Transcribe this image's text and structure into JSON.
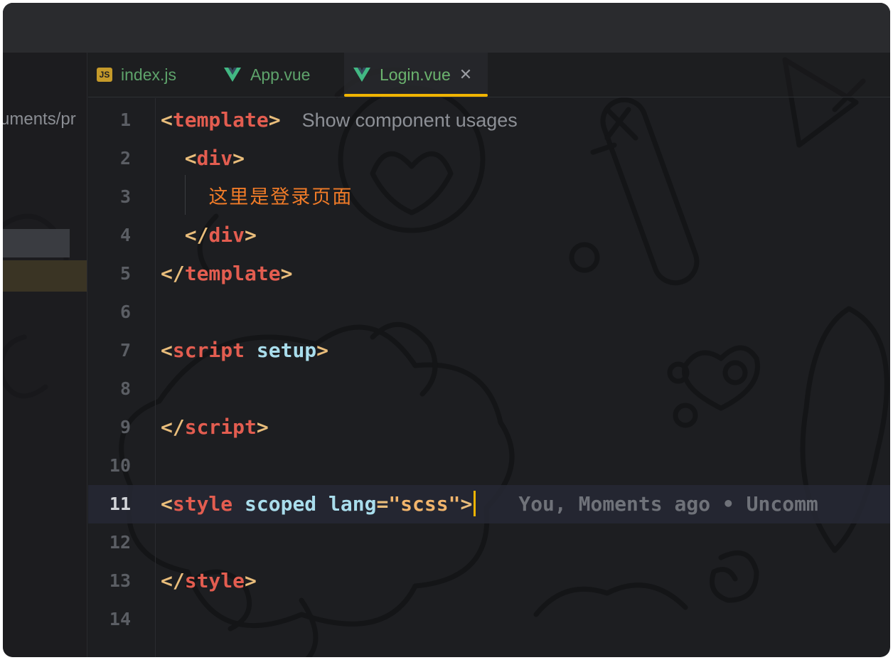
{
  "sidebar": {
    "path_fragment": "uments/pr"
  },
  "tabs": [
    {
      "label": "index.js",
      "icon": "js-file-icon",
      "badge": "JS",
      "active": false
    },
    {
      "label": "App.vue",
      "icon": "vue-file-icon",
      "active": false
    },
    {
      "label": "Login.vue",
      "icon": "vue-file-icon",
      "active": true
    }
  ],
  "colors": {
    "accent": "#f0b400",
    "vue_green": "#42b883",
    "tag": "#e35d50",
    "bracket": "#e9bd7b",
    "attr": "#a9ddec",
    "text_cn": "#f07b28"
  },
  "editor": {
    "line_numbers": [
      "1",
      "2",
      "3",
      "4",
      "5",
      "6",
      "7",
      "8",
      "9",
      "10",
      "11",
      "12",
      "13",
      "14"
    ],
    "current_line": "11",
    "inlay_hint": "Show component usages",
    "chinese_text": "这里是登录页面",
    "blame": "You, Moments ago • Uncomm",
    "tokens": {
      "template": "template",
      "div": "div",
      "script": "script",
      "setup": "setup",
      "style": "style",
      "scoped": "scoped",
      "lang": "lang",
      "scss": "\"scss\""
    }
  }
}
